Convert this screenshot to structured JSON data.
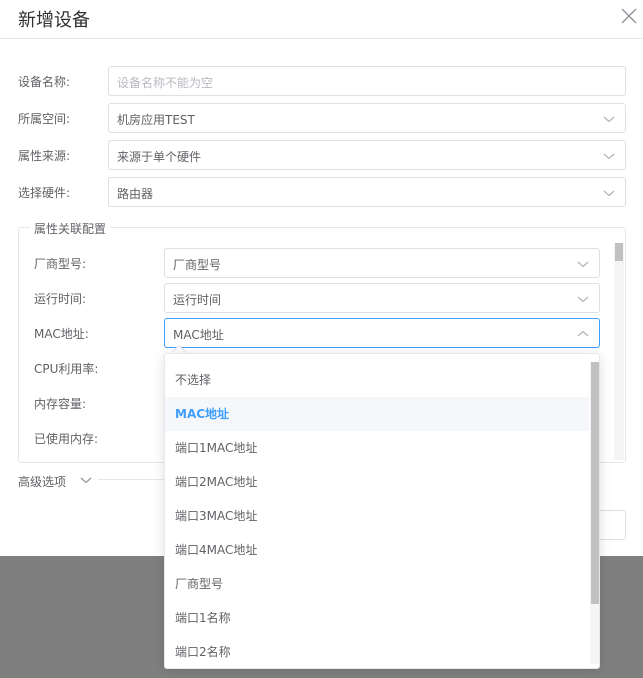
{
  "dialog": {
    "title": "新增设备",
    "fields": [
      {
        "label": "设备名称:",
        "value": "",
        "placeholder": "设备名称不能为空"
      },
      {
        "label": "所属空间:",
        "value": "机房应用TEST"
      },
      {
        "label": "属性来源:",
        "value": "来源于单个硬件"
      },
      {
        "label": "选择硬件:",
        "value": "路由器"
      }
    ],
    "mapping": {
      "legend": "属性关联配置",
      "rows": [
        {
          "label": "厂商型号:",
          "value": "厂商型号"
        },
        {
          "label": "运行时间:",
          "value": "运行时间"
        },
        {
          "label": "MAC地址:",
          "value": "MAC地址"
        },
        {
          "label": "CPU利用率:",
          "value": ""
        },
        {
          "label": "内存容量:",
          "value": ""
        },
        {
          "label": "已使用内存:",
          "value": ""
        }
      ]
    },
    "advanced": {
      "label": "高级选项"
    }
  },
  "dropdown": {
    "selected": "MAC地址",
    "options": [
      "不选择",
      "MAC地址",
      "端口1MAC地址",
      "端口2MAC地址",
      "端口3MAC地址",
      "端口4MAC地址",
      "厂商型号",
      "端口1名称",
      "端口2名称"
    ]
  },
  "colors": {
    "accent": "#409eff",
    "border": "#dcdfe6",
    "overlay": "#7f7f7f"
  }
}
